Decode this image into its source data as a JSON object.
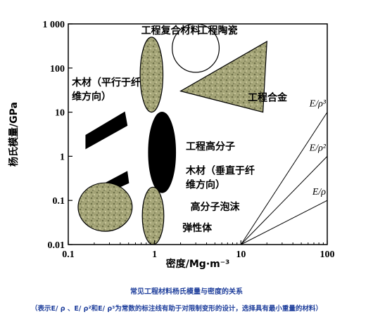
{
  "chart_data": {
    "type": "scatter",
    "xscale": "log",
    "yscale": "log",
    "xlabel": "密度/Mg·m⁻³",
    "ylabel": "杨氏模量/GPa",
    "xlim": [
      0.1,
      100
    ],
    "ylim": [
      0.01,
      1000
    ],
    "x_ticks": [
      {
        "value": 0.1,
        "label": "0.1"
      },
      {
        "value": 1,
        "label": "1"
      },
      {
        "value": 10,
        "label": "10"
      },
      {
        "value": 100,
        "label": "100"
      }
    ],
    "y_ticks": [
      {
        "value": 0.01,
        "label": "0.01"
      },
      {
        "value": 0.1,
        "label": "0.1"
      },
      {
        "value": 1,
        "label": "1"
      },
      {
        "value": 10,
        "label": "10"
      },
      {
        "value": 100,
        "label": "100"
      },
      {
        "value": 1000,
        "label": "1 000"
      }
    ],
    "regions": [
      {
        "name": "工程复合材料",
        "shape": "ellipse",
        "fill": "pattern",
        "center": [
          0.92,
          70
        ],
        "x_range": [
          0.68,
          1.25
        ],
        "y_range": [
          10,
          500
        ],
        "label_anchor": [
          0.7,
          600
        ]
      },
      {
        "name": "工程陶瓷",
        "shape": "ellipse",
        "fill": "white",
        "center": [
          3.0,
          400
        ],
        "x_range": [
          1.6,
          5.6
        ],
        "y_range": [
          80,
          1000
        ],
        "label_anchor": [
          3.2,
          600
        ]
      },
      {
        "name": "工程合金",
        "shape": "polygon",
        "fill": "pattern",
        "points": [
          [
            2.0,
            30
          ],
          [
            20,
            400
          ],
          [
            18,
            10
          ]
        ],
        "label_anchor": [
          12,
          18
        ]
      },
      {
        "name": "木材（平行于纤维方向）",
        "shape": "parallelogram",
        "fill": "black",
        "points": [
          [
            0.16,
            3.0
          ],
          [
            0.45,
            10
          ],
          [
            0.48,
            5
          ],
          [
            0.16,
            1.5
          ]
        ],
        "label_anchor": [
          0.11,
          40
        ]
      },
      {
        "name": "工程高分子",
        "shape": "ellipse",
        "fill": "black",
        "center": [
          1.2,
          1.1
        ],
        "x_range": [
          0.85,
          1.75
        ],
        "y_range": [
          0.15,
          10
        ],
        "label_anchor": [
          2.3,
          1.4
        ]
      },
      {
        "name": "木材（垂直于纤维方向）",
        "shape": "parallelogram",
        "fill": "black",
        "points": [
          [
            0.22,
            0.2
          ],
          [
            0.48,
            0.45
          ],
          [
            0.5,
            0.25
          ],
          [
            0.22,
            0.12
          ]
        ],
        "label_anchor": [
          2.3,
          0.4
        ]
      },
      {
        "name": "高分子泡沫",
        "shape": "ellipse",
        "fill": "pattern",
        "center": [
          0.27,
          0.07
        ],
        "x_range": [
          0.13,
          0.55
        ],
        "y_range": [
          0.02,
          0.25
        ],
        "label_anchor": [
          2.6,
          0.06
        ]
      },
      {
        "name": "弹性体",
        "shape": "ellipse",
        "fill": "pattern",
        "center": [
          0.95,
          0.035
        ],
        "x_range": [
          0.72,
          1.28
        ],
        "y_range": [
          0.01,
          0.2
        ],
        "label_anchor": [
          2.1,
          0.02
        ]
      }
    ],
    "guide_lines": [
      {
        "label": "E/ρ³",
        "from": [
          10,
          0.01
        ],
        "to": [
          100,
          10
        ]
      },
      {
        "label": "E/ρ²",
        "from": [
          10,
          0.01
        ],
        "to": [
          100,
          1
        ]
      },
      {
        "label": "E/ρ",
        "from": [
          10,
          0.01
        ],
        "to": [
          100,
          0.1
        ]
      }
    ]
  },
  "caption": {
    "title": "常见工程材料杨氏模量与密度的关系",
    "note": "（表示E/ ρ 、E/ ρ²和E/ ρ³为常数的标注线有助于对限制变形的设计，选择具有最小重量的材料）"
  }
}
